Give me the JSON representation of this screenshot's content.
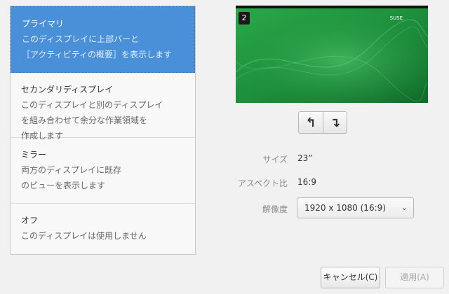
{
  "modes": [
    {
      "title": "プライマリ",
      "desc": "このディスプレイに上部バーと\n［アクティビティの概要］を表示します",
      "selected": true
    },
    {
      "title": "セカンダリディスプレイ",
      "desc": "このディスプレイと別のディスプレイ\nを組み合わせて余分な作業領域を\n作成します",
      "selected": false
    },
    {
      "title": "ミラー",
      "desc": "両方のディスプレイに既存\nのビューを表示します",
      "selected": false
    },
    {
      "title": "オフ",
      "desc": "このディスプレイは使用しません",
      "selected": false
    }
  ],
  "preview": {
    "monitor_number": "2",
    "logo_text": "SUSE"
  },
  "rotate": {
    "left_glyph": "↰",
    "right_glyph": "↴"
  },
  "props": {
    "size_label": "サイズ",
    "size_value": "23”",
    "aspect_label": "アスペクト比",
    "aspect_value": "16:9",
    "resolution_label": "解像度",
    "resolution_value": "1920 x 1080 (16:9)"
  },
  "buttons": {
    "cancel": "キャンセル(C)",
    "apply": "適用(A)"
  },
  "colors": {
    "selected_bg": "#4a90d9",
    "wallpaper": "#1f8f3a"
  }
}
